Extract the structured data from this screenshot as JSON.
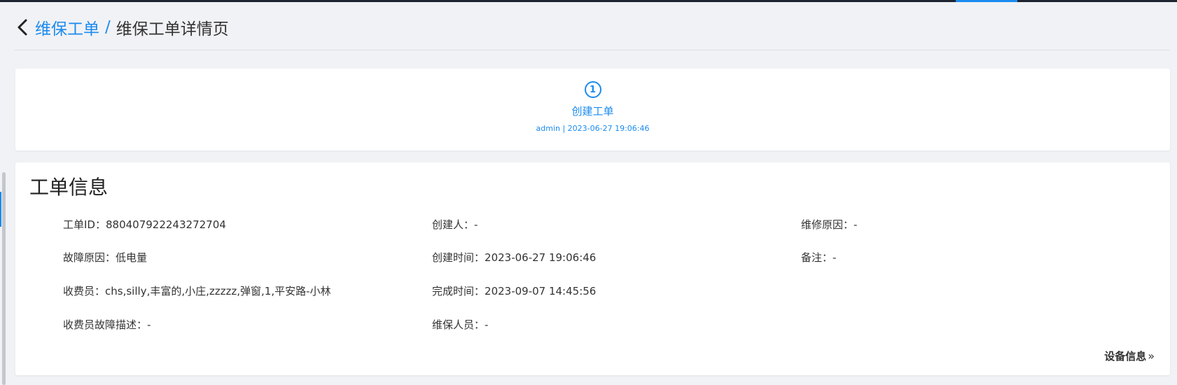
{
  "breadcrumb": {
    "parent": "维保工单",
    "separator": "/",
    "current": "维保工单详情页"
  },
  "steps": [
    {
      "number": "1",
      "title": "创建工单",
      "description": "admin | 2023-06-27 19:06:46"
    }
  ],
  "order_info": {
    "title": "工单信息",
    "fields": {
      "order_id": {
        "label": "工单ID",
        "value": "880407922243272704"
      },
      "fault_reason": {
        "label": "故障原因",
        "value": "低电量"
      },
      "cashier": {
        "label": "收费员",
        "value": "chs,silly,丰富的,小庄,zzzzz,弹窗,1,平安路-小林"
      },
      "cashier_fault_desc": {
        "label": "收费员故障描述",
        "value": "-"
      },
      "creator": {
        "label": "创建人",
        "value": "-"
      },
      "created_time": {
        "label": "创建时间",
        "value": "2023-06-27 19:06:46"
      },
      "completed_time": {
        "label": "完成时间",
        "value": "2023-09-07 14:45:56"
      },
      "maintainer": {
        "label": "维保人员",
        "value": "-"
      },
      "repair_reason": {
        "label": "维修原因",
        "value": "-"
      },
      "remark": {
        "label": "备注",
        "value": "-"
      }
    },
    "device_link": "设备信息",
    "device_link_icon": "»"
  },
  "colors": {
    "accent": "#1b8bef",
    "background": "#f1f2f5",
    "card": "#ffffff",
    "text": "#333333",
    "top_bar": "#1f2530"
  },
  "icons": {
    "back": "chevron-left-icon",
    "device_link": "double-chevron-right-icon"
  }
}
